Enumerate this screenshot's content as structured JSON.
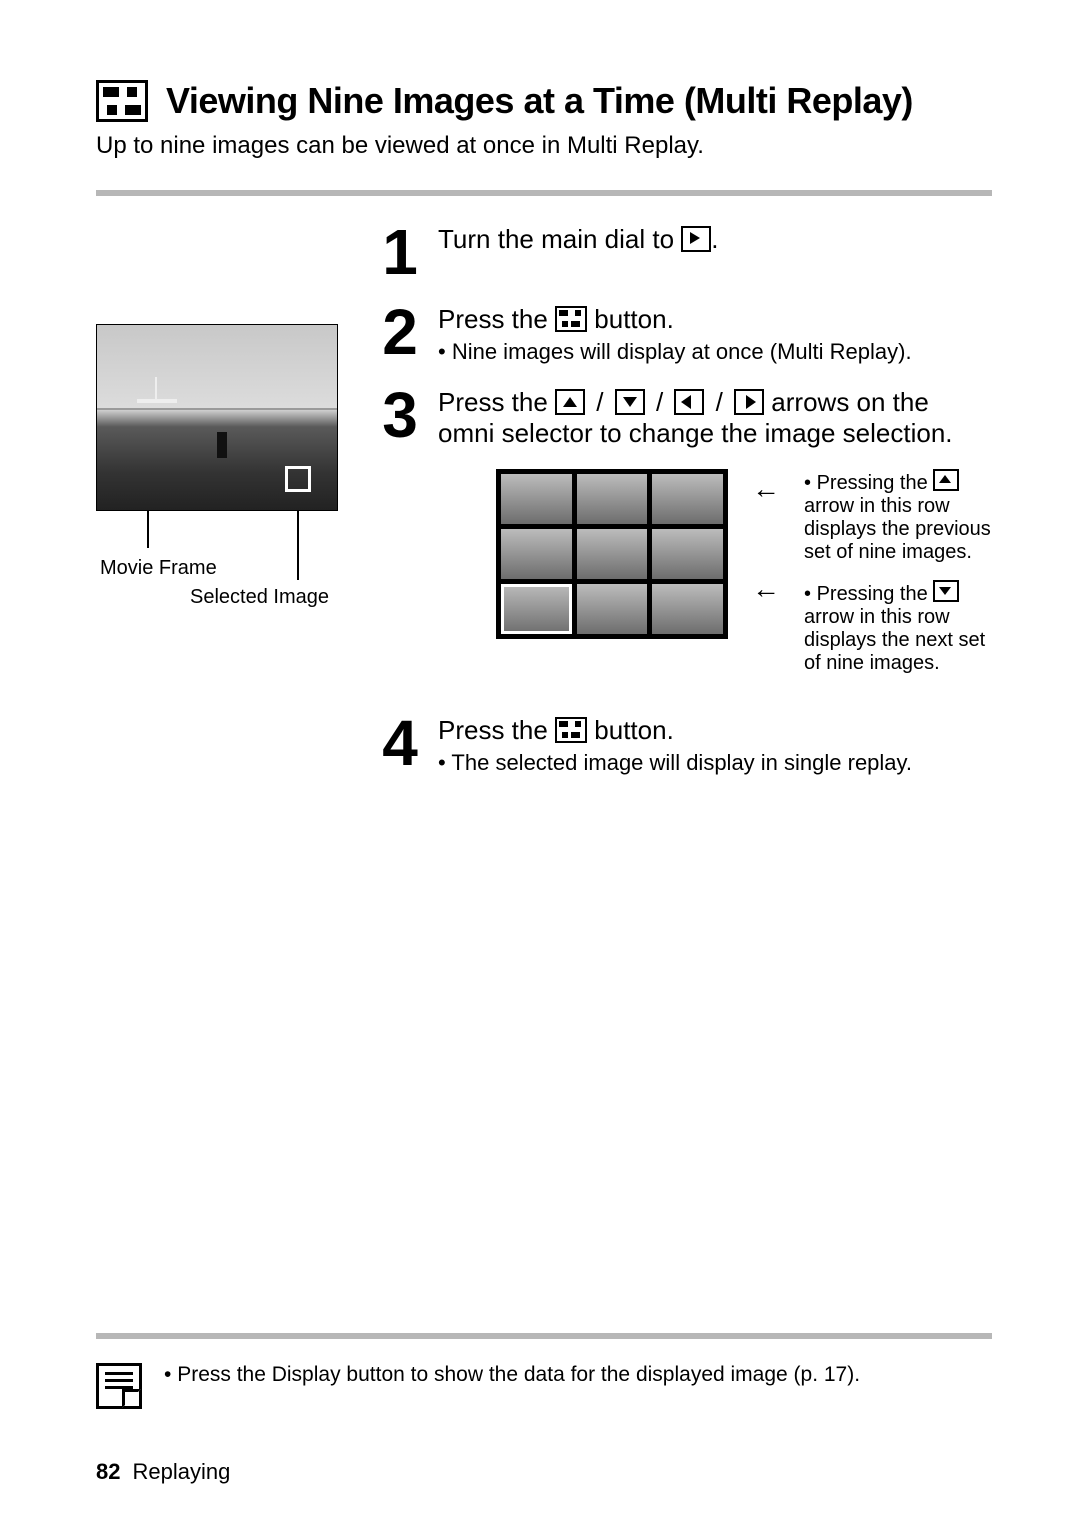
{
  "title": "Viewing Nine Images at a Time (Multi Replay)",
  "intro": "Up to nine images can be viewed at once in Multi Replay.",
  "captions": {
    "movie_frame": "Movie Frame",
    "selected_image": "Selected Image"
  },
  "steps": {
    "s1": {
      "num": "1",
      "pre": "Turn the main dial to ",
      "post": "."
    },
    "s2": {
      "num": "2",
      "pre": "Press the ",
      "post": " button.",
      "bullet": "Nine images will display at once (Multi Replay)."
    },
    "s3": {
      "num": "3",
      "pre": "Press the ",
      "mid": " arrows on the omni selector to change the image selection."
    },
    "s4": {
      "num": "4",
      "pre": "Press the ",
      "post": " button.",
      "bullet": "The selected image will display in single replay."
    }
  },
  "side_notes": {
    "up_pre": "Pressing the ",
    "up_post": " arrow in this row displays the previous set of nine images.",
    "down_pre": "Pressing the ",
    "down_post": " arrow in this row displays the next set of nine images."
  },
  "bottom_note": "Press the Display button to show the data for the displayed image (p. 17).",
  "footer": {
    "page": "82",
    "section": "Replaying"
  },
  "slash": " / "
}
